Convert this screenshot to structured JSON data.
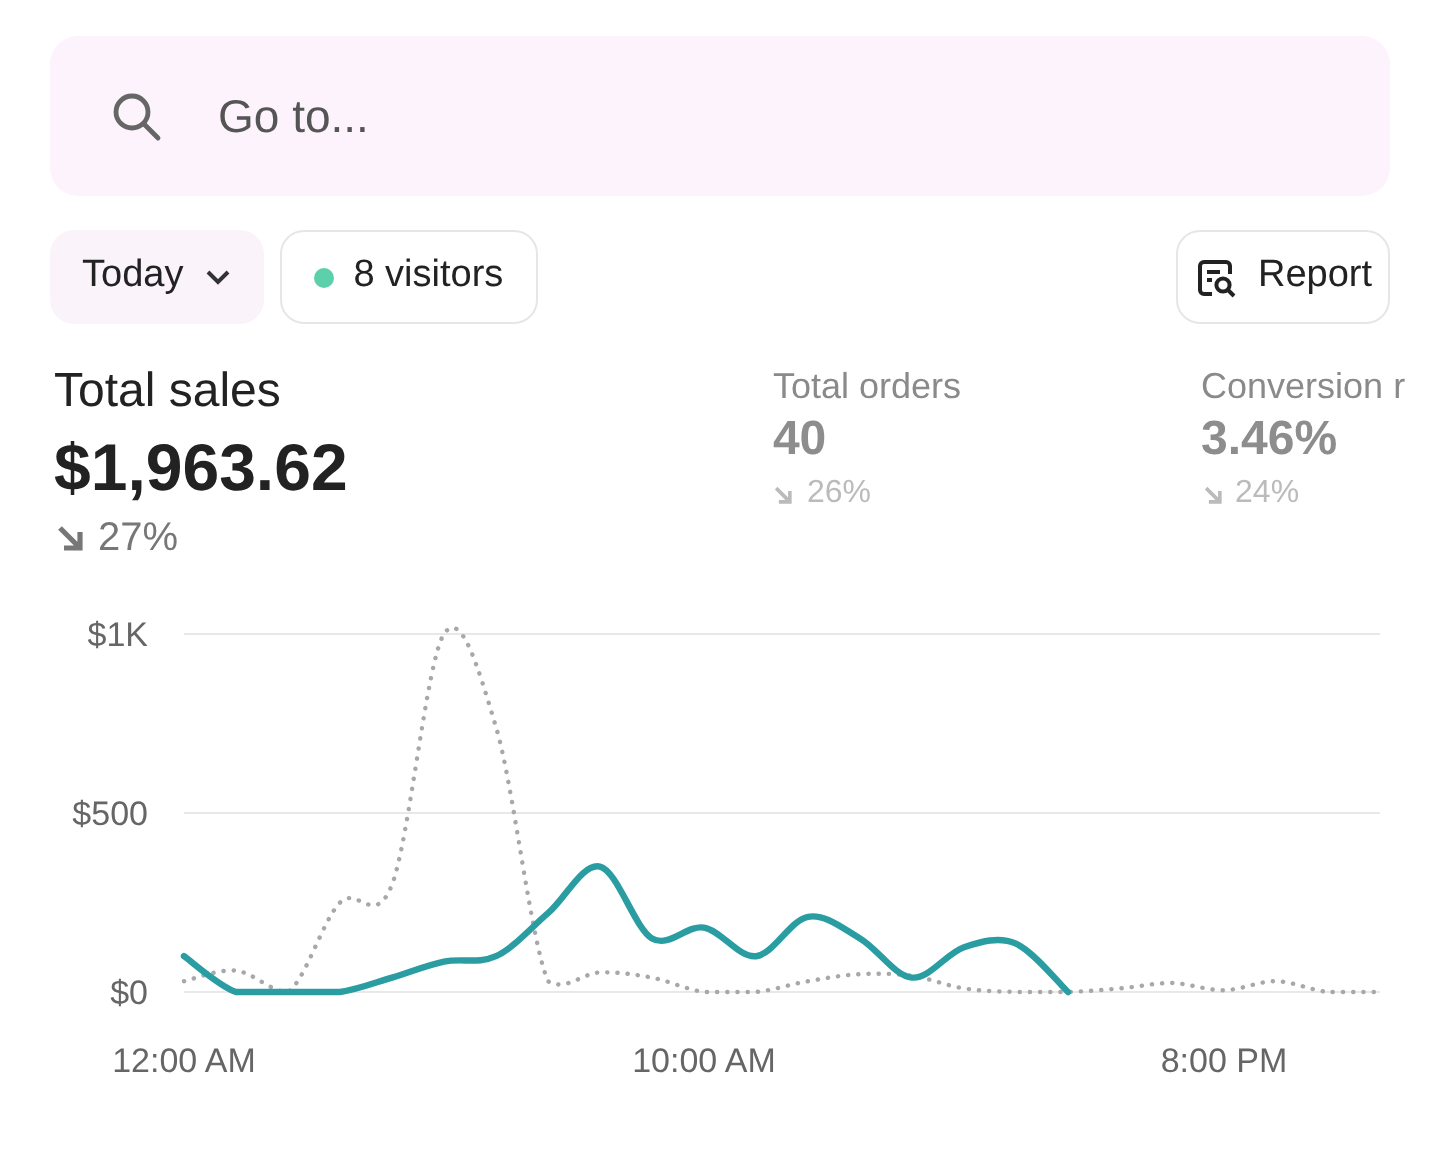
{
  "search": {
    "placeholder": "Go to..."
  },
  "toolbar": {
    "date_filter": {
      "label": "Today"
    },
    "visitors": {
      "label": "8 visitors"
    },
    "report": {
      "label": "Report"
    }
  },
  "metrics": [
    {
      "kind": "primary",
      "label": "Total sales",
      "value": "$1,963.62",
      "declined": true,
      "change": "27%"
    },
    {
      "kind": "secondary",
      "label": "Total orders",
      "value": "40",
      "declined": true,
      "change": "26%"
    },
    {
      "kind": "secondary",
      "label": "Conversion r",
      "value": "3.46%",
      "declined": true,
      "change": "24%"
    }
  ],
  "chart": {
    "chart_data": {
      "type": "line",
      "x": [
        0,
        1,
        2,
        3,
        4,
        5,
        6,
        7,
        8,
        9,
        10,
        11,
        12,
        13,
        14,
        15,
        16,
        17,
        18,
        19,
        20,
        21,
        22,
        23
      ],
      "xlim": [
        0,
        23
      ],
      "ylim": [
        0,
        1000
      ],
      "xticks": [
        {
          "value": 0,
          "label": "12:00 AM"
        },
        {
          "value": 10,
          "label": "10:00 AM"
        },
        {
          "value": 20,
          "label": "8:00 PM"
        }
      ],
      "yticks": [
        {
          "value": 0,
          "label": "$0"
        },
        {
          "value": 500,
          "label": "$500"
        },
        {
          "value": 1000,
          "label": "$1K"
        }
      ],
      "series": [
        {
          "line_style": "solid",
          "color": "#2a9da2",
          "values": [
            100,
            0,
            0,
            0,
            40,
            85,
            100,
            220,
            350,
            150,
            180,
            100,
            210,
            150,
            40,
            125,
            135,
            0,
            null,
            null,
            null,
            null,
            null,
            null
          ]
        },
        {
          "line_style": "dotted",
          "color": "#a8a8a8",
          "values": [
            30,
            60,
            0,
            250,
            300,
            1000,
            740,
            30,
            55,
            40,
            0,
            0,
            30,
            50,
            45,
            10,
            0,
            0,
            10,
            25,
            5,
            30,
            0,
            0
          ]
        }
      ]
    }
  }
}
